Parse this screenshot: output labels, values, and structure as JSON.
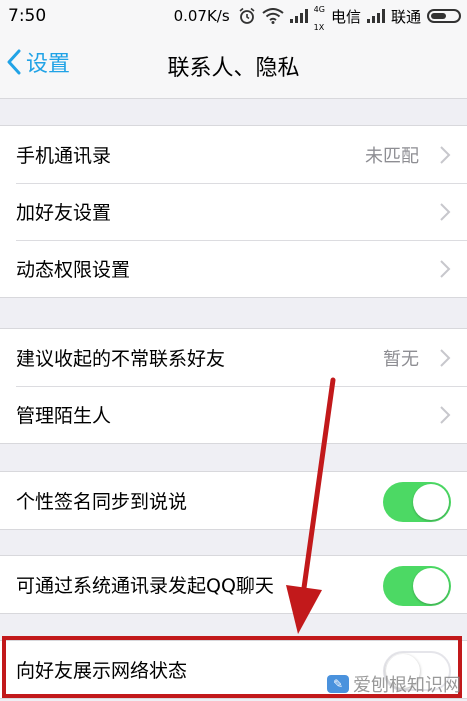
{
  "status_bar": {
    "time": "7:50",
    "speed": "0.07K/s",
    "net_small_top": "4G",
    "net_small_bottom": "1X",
    "carrier1": "电信",
    "carrier2": "联通"
  },
  "nav": {
    "back_label": "设置",
    "title": "联系人、隐私"
  },
  "group1": [
    {
      "label": "手机通讯录",
      "value": "未匹配"
    },
    {
      "label": "加好友设置",
      "value": ""
    },
    {
      "label": "动态权限设置",
      "value": ""
    }
  ],
  "group2": [
    {
      "label": "建议收起的不常联系好友",
      "value": "暂无"
    },
    {
      "label": "管理陌生人",
      "value": ""
    }
  ],
  "group3": [
    {
      "label": "个性签名同步到说说",
      "state": "on"
    }
  ],
  "group4": [
    {
      "label": "可通过系统通讯录发起QQ聊天",
      "state": "on"
    }
  ],
  "group5": [
    {
      "label": "向好友展示网络状态",
      "state": "off"
    }
  ],
  "watermark": "爱刨根知识网",
  "colors": {
    "accent": "#21a3e6",
    "toggle_on": "#4cd964",
    "annotation": "#c2191b"
  }
}
